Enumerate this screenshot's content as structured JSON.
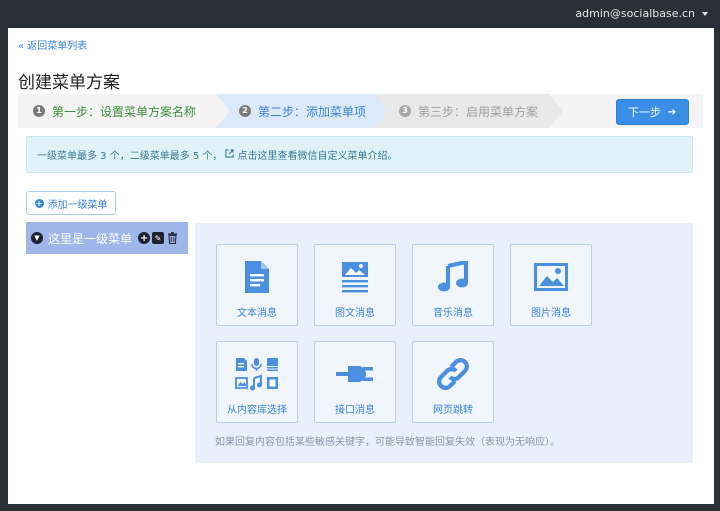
{
  "header": {
    "user": "admin@socialbase.cn"
  },
  "nav": {
    "back_label": "« 返回菜单列表"
  },
  "page": {
    "title": "创建菜单方案"
  },
  "steps": [
    {
      "num": "1",
      "label": "第一步：设置菜单方案名称"
    },
    {
      "num": "2",
      "label": "第二步：添加菜单项"
    },
    {
      "num": "3",
      "label": "第三步：启用菜单方案"
    }
  ],
  "next_button": {
    "label": "下一步",
    "arrow": "➔"
  },
  "info": {
    "text": "一级菜单最多 3 个，二级菜单最多 5 个，",
    "link": "点击这里查看微信自定义菜单介绍。",
    "icon": "external-link-icon"
  },
  "add_button": {
    "label": "添加一级菜单",
    "icon": "plus-circle-icon"
  },
  "menu_item": {
    "label": "这里是一级菜单",
    "chev": "▼",
    "add": "+",
    "edit": "✎",
    "del": "🗑"
  },
  "tiles": [
    {
      "label": "文本消息",
      "icon": "document-text-icon"
    },
    {
      "label": "图文消息",
      "icon": "article-news-icon"
    },
    {
      "label": "音乐消息",
      "icon": "music-note-icon"
    },
    {
      "label": "图片消息",
      "icon": "image-icon"
    },
    {
      "label": "从内容库选择",
      "icon": "content-library-icon"
    },
    {
      "label": "接口消息",
      "icon": "plug-icon"
    },
    {
      "label": "网页跳转",
      "icon": "link-icon"
    }
  ],
  "notice": "如果回复内容包括某些敏感关键字，可能导致智能回复失效（表现为无响应）。",
  "colors": {
    "accent": "#3a84d6",
    "tile_icon": "#4a8fe0",
    "selected_menu": "#9eb6ea"
  }
}
